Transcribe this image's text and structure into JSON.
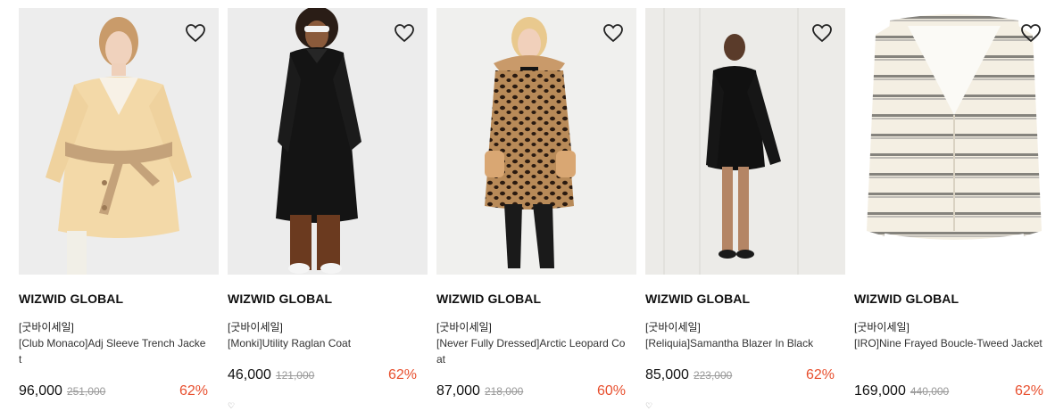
{
  "colors": {
    "discount": "#e8502f",
    "price": "#111111",
    "strike": "#999999"
  },
  "products": [
    {
      "brand": "WIZWID GLOBAL",
      "tag": "[굿바이세일]",
      "name": "[Club Monaco]Adj Sleeve Trench Jacket",
      "price": "96,000",
      "original": "251,000",
      "discount": "62%",
      "icon": "heart-outline-icon"
    },
    {
      "brand": "WIZWID GLOBAL",
      "tag": "[굿바이세일]",
      "name": "[Monki]Utility Raglan Coat",
      "price": "46,000",
      "original": "121,000",
      "discount": "62%",
      "icon": "heart-outline-icon"
    },
    {
      "brand": "WIZWID GLOBAL",
      "tag": "[굿바이세일]",
      "name": "[Never Fully Dressed]Arctic Leopard Coat",
      "price": "87,000",
      "original": "218,000",
      "discount": "60%",
      "icon": "heart-outline-icon"
    },
    {
      "brand": "WIZWID GLOBAL",
      "tag": "[굿바이세일]",
      "name": "[Reliquia]Samantha Blazer In Black",
      "price": "85,000",
      "original": "223,000",
      "discount": "62%",
      "icon": "heart-outline-icon"
    },
    {
      "brand": "WIZWID GLOBAL",
      "tag": "[굿바이세일]",
      "name": "[IRO]Nine Frayed Boucle-Tweed Jacket",
      "price": "169,000",
      "original": "440,000",
      "discount": "62%",
      "icon": "heart-outline-icon"
    }
  ]
}
